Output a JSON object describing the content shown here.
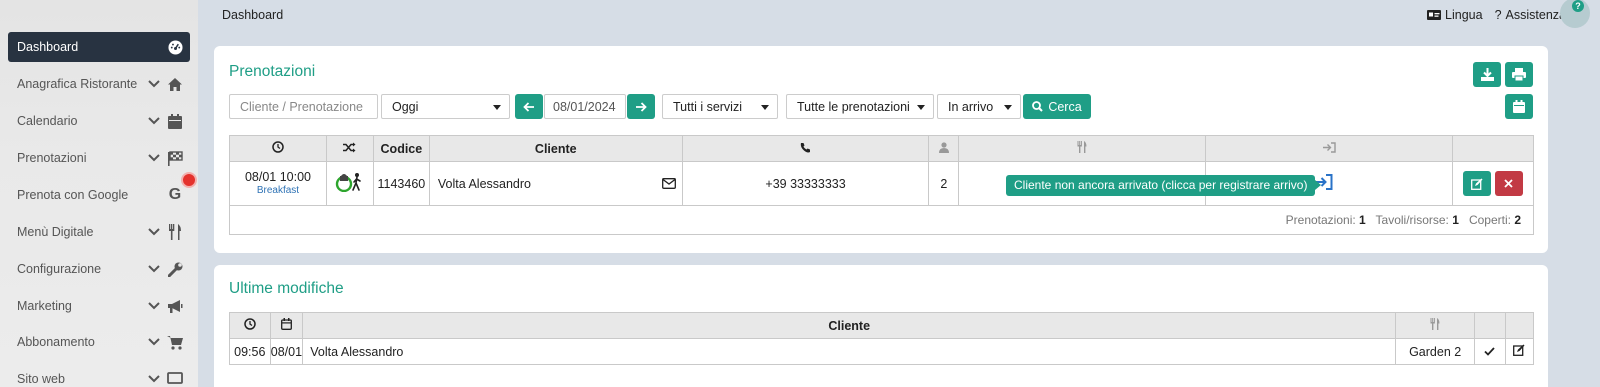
{
  "sidebar": {
    "items": [
      {
        "label": "Dashboard",
        "icon": "dashboard-icon",
        "active": true
      },
      {
        "label": "Anagrafica Ristorante",
        "icon": "home-icon"
      },
      {
        "label": "Calendario",
        "icon": "calendar-icon"
      },
      {
        "label": "Prenotazioni",
        "icon": "flag-icon"
      },
      {
        "label": "Prenota con Google",
        "icon": "google-icon"
      },
      {
        "label": "Menù Digitale",
        "icon": "cutlery-icon"
      },
      {
        "label": "Configurazione",
        "icon": "wrench-icon"
      },
      {
        "label": "Marketing",
        "icon": "megaphone-icon"
      },
      {
        "label": "Abbonamento",
        "icon": "cart-icon"
      },
      {
        "label": "Sito web",
        "icon": "monitor-icon"
      }
    ]
  },
  "topbar": {
    "breadcrumb": "Dashboard",
    "language": "Lingua",
    "help": "Assistenza",
    "help_bubble": "?"
  },
  "bookings": {
    "title": "Prenotazioni",
    "search_placeholder": "Cliente / Prenotazione",
    "period": "Oggi",
    "date": "08/01/2024",
    "services": "Tutti i servizi",
    "bookings_filter": "Tutte le prenotazioni",
    "status": "In arrivo",
    "search_button": "Cerca",
    "columns": {
      "code": "Codice",
      "client": "Cliente"
    },
    "row": {
      "datetime": "08/01 10:00",
      "service": "Breakfast",
      "code": "1143460",
      "client": "Volta Alessandro",
      "phone": "+39 33333333",
      "covers": "2"
    },
    "tooltip": "Cliente non ancora arrivato (clicca per registrare arrivo)",
    "footer": {
      "bookings_label": "Prenotazioni:",
      "bookings_value": "1",
      "tables_label": "Tavoli/risorse:",
      "tables_value": "1",
      "covers_label": "Coperti:",
      "covers_value": "2"
    }
  },
  "changes": {
    "title": "Ultime modifiche",
    "columns": {
      "client": "Cliente"
    },
    "row": {
      "time": "09:56",
      "date": "08/01",
      "client": "Volta Alessandro",
      "table": "Garden 2"
    }
  },
  "colors": {
    "accent": "#1f9e86",
    "danger": "#c23a44",
    "sidebar_active": "#283341"
  }
}
